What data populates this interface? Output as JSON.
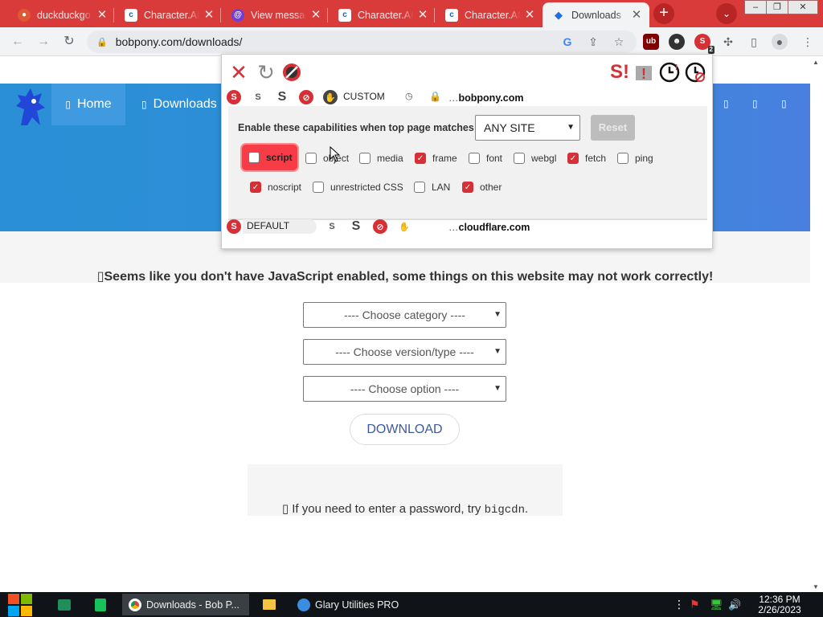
{
  "browser": {
    "tabs": [
      {
        "title": "duckduckgo",
        "favicon": "duckduckgo-icon",
        "active": false
      },
      {
        "title": "Character.AI",
        "favicon": "character-ai-icon",
        "active": false
      },
      {
        "title": "View message",
        "favicon": "message-icon",
        "active": false
      },
      {
        "title": "Character.AI",
        "favicon": "character-ai-icon",
        "active": false
      },
      {
        "title": "Character.AI",
        "favicon": "character-ai-icon",
        "active": false
      },
      {
        "title": "Downloads",
        "favicon": "bobpony-icon",
        "active": true
      }
    ],
    "new_tab": "+",
    "tab_menu": "⌄",
    "url": "bobpony.com/downloads/",
    "ext_badge": "2",
    "accent": "#d93b3b"
  },
  "site": {
    "nav": {
      "home": "Home",
      "downloads": "Downloads"
    },
    "js_warning": "Seems like you don't have JavaScript enabled, some things on this website may not work correctly!",
    "selects": {
      "category": "---- Choose category ----",
      "version": "---- Choose version/type ----",
      "option": "---- Choose option ----"
    },
    "download_button": "DOWNLOAD",
    "hint_prefix": "If you need to enter a password, try",
    "hint_code": "bigcdn",
    "hint_suffix": "."
  },
  "noscript": {
    "custom_preset": "CUSTOM",
    "custom_site_prefix": "…",
    "custom_site": "bobpony.com",
    "match_label": "Enable these capabilities when top page matches",
    "match_value": "ANY SITE",
    "reset_label": "Reset",
    "capabilities": [
      {
        "label": "script",
        "checked": false
      },
      {
        "label": "object",
        "checked": false
      },
      {
        "label": "media",
        "checked": false
      },
      {
        "label": "frame",
        "checked": true
      },
      {
        "label": "font",
        "checked": false
      },
      {
        "label": "webgl",
        "checked": false
      },
      {
        "label": "fetch",
        "checked": true
      },
      {
        "label": "ping",
        "checked": false
      },
      {
        "label": "noscript",
        "checked": true
      },
      {
        "label": "unrestricted CSS",
        "checked": false
      },
      {
        "label": "LAN",
        "checked": false
      },
      {
        "label": "other",
        "checked": true
      }
    ],
    "default_preset": "DEFAULT",
    "default_site_prefix": "…",
    "default_site": "cloudflare.com"
  },
  "taskbar": {
    "apps": [
      {
        "label": "Downloads - Bob P...",
        "icon": "chrome-icon",
        "active": true
      },
      {
        "label": "Glary Utilities PRO",
        "icon": "glary-icon",
        "active": false
      }
    ],
    "time": "12:36 PM",
    "date": "2/26/2023"
  }
}
